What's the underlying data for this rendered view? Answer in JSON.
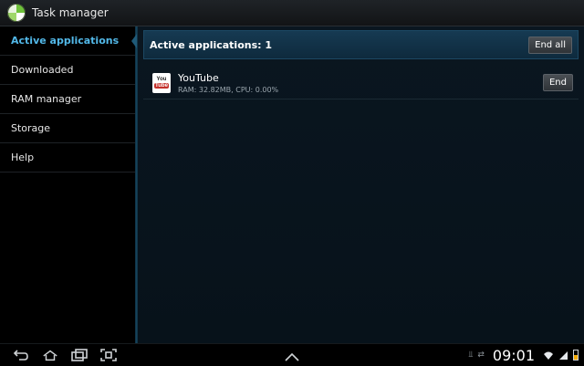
{
  "titlebar": {
    "title": "Task manager",
    "logo_icon": "task-manager-pie-icon"
  },
  "sidebar": {
    "items": [
      {
        "label": "Active applications",
        "active": true
      },
      {
        "label": "Downloaded",
        "active": false
      },
      {
        "label": "RAM manager",
        "active": false
      },
      {
        "label": "Storage",
        "active": false
      },
      {
        "label": "Help",
        "active": false
      }
    ]
  },
  "main": {
    "header_title": "Active applications: 1",
    "end_all_label": "End all",
    "apps": [
      {
        "name": "YouTube",
        "stats": "RAM: 32.82MB, CPU: 0.00%",
        "icon": "youtube-icon",
        "icon_text_top": "You",
        "icon_text_bottom": "Tube",
        "end_label": "End"
      }
    ]
  },
  "system_bar": {
    "clock": "09:01",
    "battery_level": 0.5,
    "icons": [
      "back-icon",
      "home-icon",
      "recent-apps-icon",
      "screenshot-icon",
      "up-arrow-icon",
      "usb-icon",
      "sync-icon",
      "wifi-icon",
      "signal-icon",
      "battery-icon"
    ]
  },
  "colors": {
    "accent": "#52b8e8",
    "header_bg": "#163a52",
    "panel_bg": "#0a1620",
    "battery": "#f2a900",
    "youtube_red": "#c4302b"
  }
}
